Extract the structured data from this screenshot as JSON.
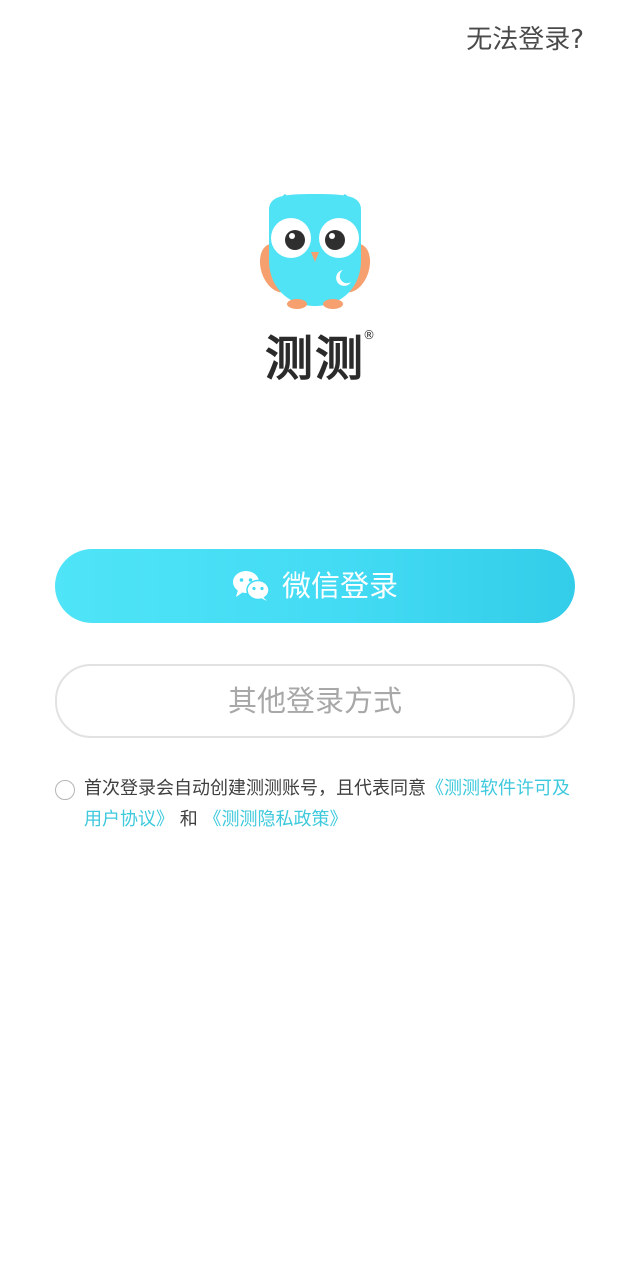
{
  "header": {
    "help_link": "无法登录?"
  },
  "brand": {
    "logo_icon": "owl-mascot-icon",
    "app_name": "测测",
    "registered_mark": "®"
  },
  "login": {
    "wechat_icon": "wechat-icon",
    "wechat_label": "微信登录",
    "other_label": "其他登录方式"
  },
  "agreement": {
    "checked": false,
    "text_prefix": "首次登录会自动创建测测账号，且代表同意",
    "license_link": "《测测软件许可及用户协议》",
    "joiner": "和",
    "privacy_link": "《测测隐私政策》"
  },
  "colors": {
    "accent": "#43dbf4",
    "link": "#3ec9dd",
    "owl_body": "#4fe3f5",
    "owl_wing": "#f5a06e"
  }
}
